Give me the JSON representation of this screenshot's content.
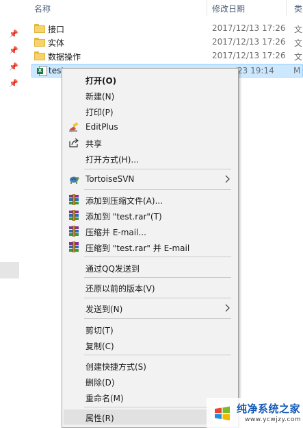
{
  "header": {
    "name_col": "名称",
    "date_col": "修改日期",
    "type_col": "类"
  },
  "files": [
    {
      "name": "接口",
      "date": "2017/12/13 17:26",
      "type": "文"
    },
    {
      "name": "实体",
      "date": "2017/12/13 17:26",
      "type": "文"
    },
    {
      "name": "数据操作",
      "date": "2017/12/13 17:26",
      "type": "文"
    },
    {
      "name": "test",
      "date": "/23 19:14",
      "type": "M"
    }
  ],
  "context_menu": {
    "items": [
      {
        "label": "打开(O)",
        "bold": true
      },
      {
        "label": "新建(N)"
      },
      {
        "label": "打印(P)"
      },
      {
        "label": "EditPlus",
        "icon": "editplus-icon"
      },
      {
        "label": "共享",
        "icon": "share-icon"
      },
      {
        "label": "打开方式(H)..."
      },
      {
        "label": "TortoiseSVN",
        "icon": "tortoisesvn-icon",
        "submenu": true
      },
      {
        "label": "添加到压缩文件(A)...",
        "icon": "winrar-icon"
      },
      {
        "label": "添加到 \"test.rar\"(T)",
        "icon": "winrar-icon"
      },
      {
        "label": "压缩并 E-mail...",
        "icon": "winrar-icon"
      },
      {
        "label": "压缩到 \"test.rar\" 并 E-mail",
        "icon": "winrar-icon"
      },
      {
        "label": "通过QQ发送到"
      },
      {
        "label": "还原以前的版本(V)"
      },
      {
        "label": "发送到(N)",
        "submenu": true
      },
      {
        "label": "剪切(T)"
      },
      {
        "label": "复制(C)"
      },
      {
        "label": "创建快捷方式(S)"
      },
      {
        "label": "删除(D)"
      },
      {
        "label": "重命名(M)"
      },
      {
        "label": "属性(R)"
      }
    ]
  },
  "watermark": {
    "title": "纯净系统之家",
    "url": "www.ycwjzy.com"
  },
  "colors": {
    "selection_bg": "#cce8ff",
    "selection_border": "#99d1ff",
    "menu_bg": "#f2f2f2",
    "menu_hover": "#e1e1e1",
    "header_text": "#4c607a",
    "watermark_blue": "#1458b8"
  }
}
